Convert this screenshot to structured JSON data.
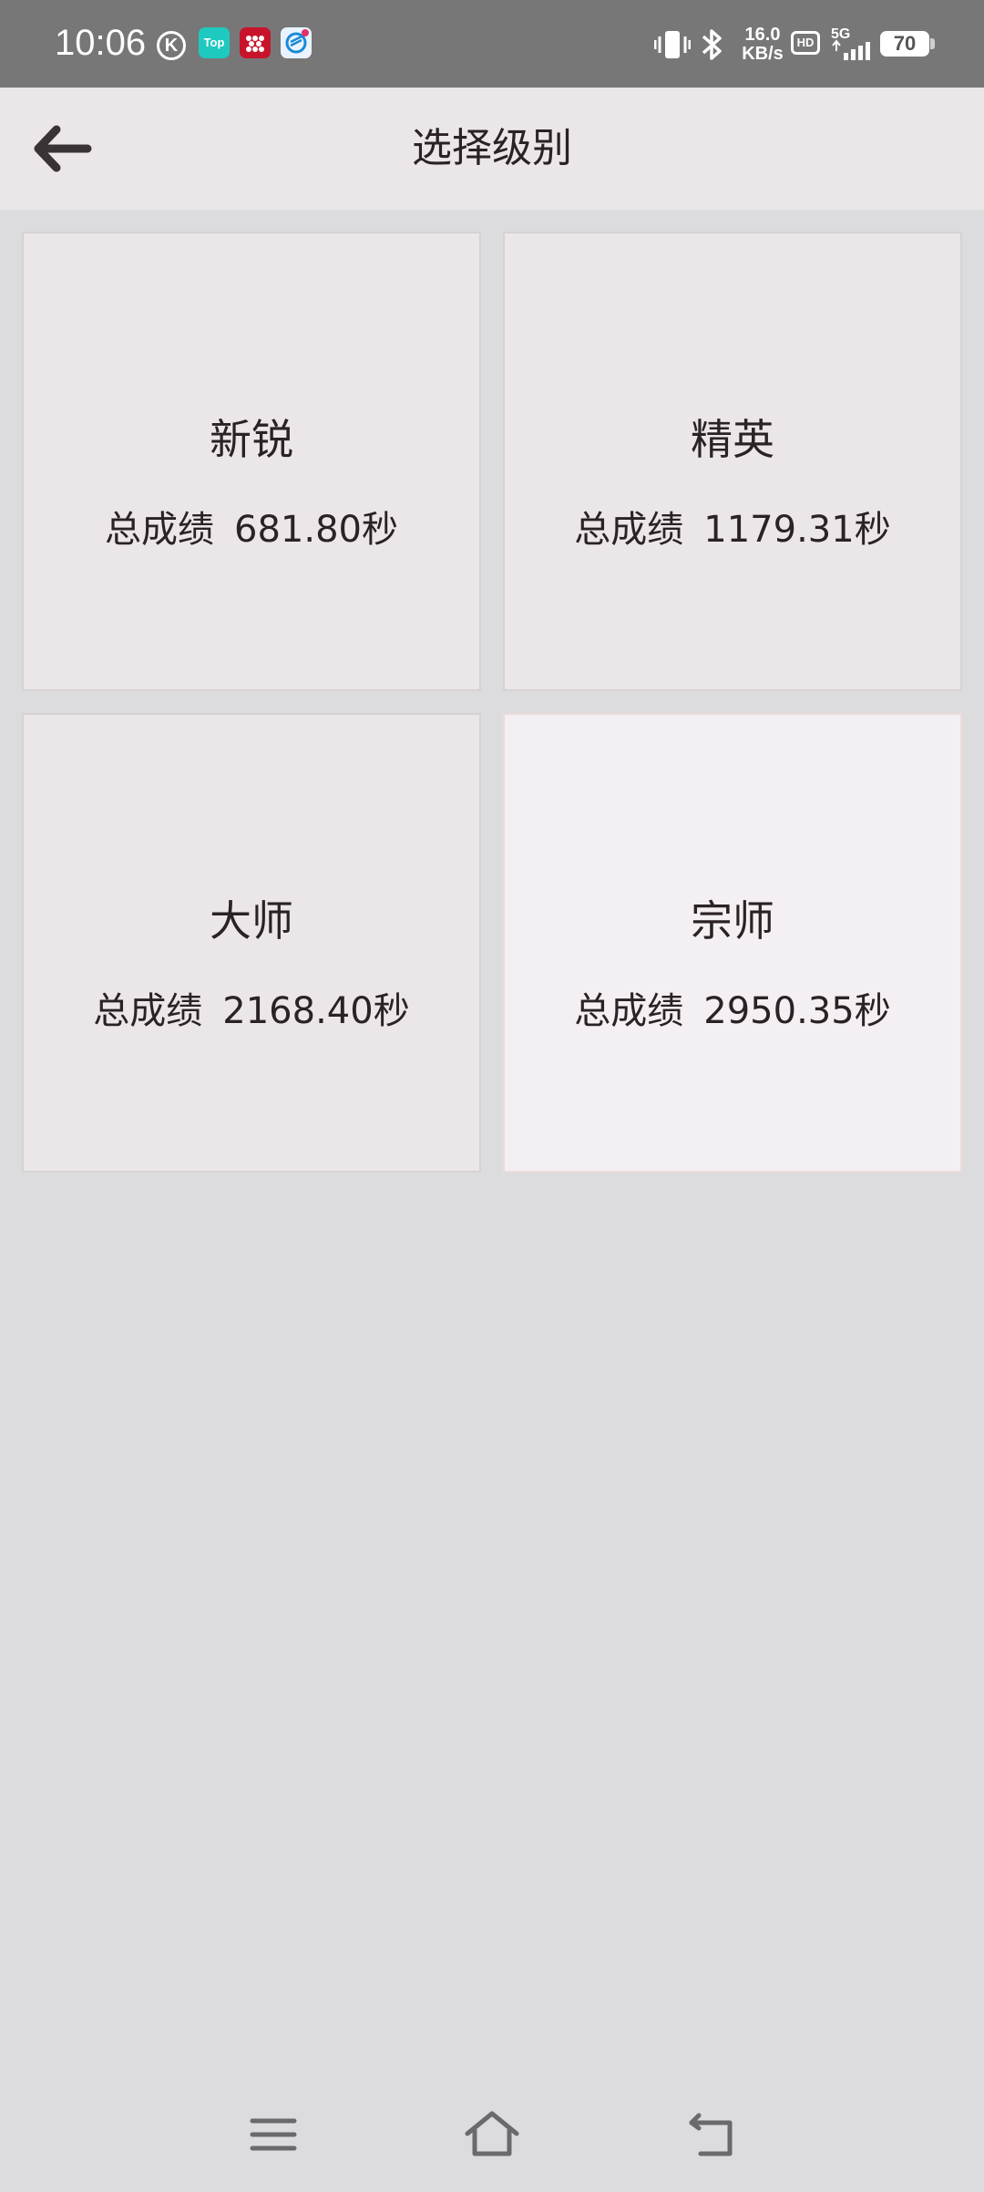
{
  "status_bar": {
    "time": "10:06",
    "k_label": "K",
    "top_label": "Top",
    "speed_value": "16.0",
    "speed_unit": "KB/s",
    "hd_label": "HD",
    "network": "5G",
    "battery": "70"
  },
  "header": {
    "title": "选择级别",
    "back_icon": "arrow-left-icon"
  },
  "levels": [
    {
      "name": "新锐",
      "score_label": "总成绩",
      "score": "681.80秒"
    },
    {
      "name": "精英",
      "score_label": "总成绩",
      "score": "1179.31秒"
    },
    {
      "name": "大师",
      "score_label": "总成绩",
      "score": "2168.40秒"
    },
    {
      "name": "宗师",
      "score_label": "总成绩",
      "score": "2950.35秒"
    }
  ],
  "colors": {
    "background": "#dcdcde",
    "card": "#ebe7e8",
    "card_highlight": "#f4eff2",
    "status_bar": "#777777"
  },
  "nav_bar": {
    "icons": [
      "menu-icon",
      "home-icon",
      "back-icon"
    ]
  }
}
